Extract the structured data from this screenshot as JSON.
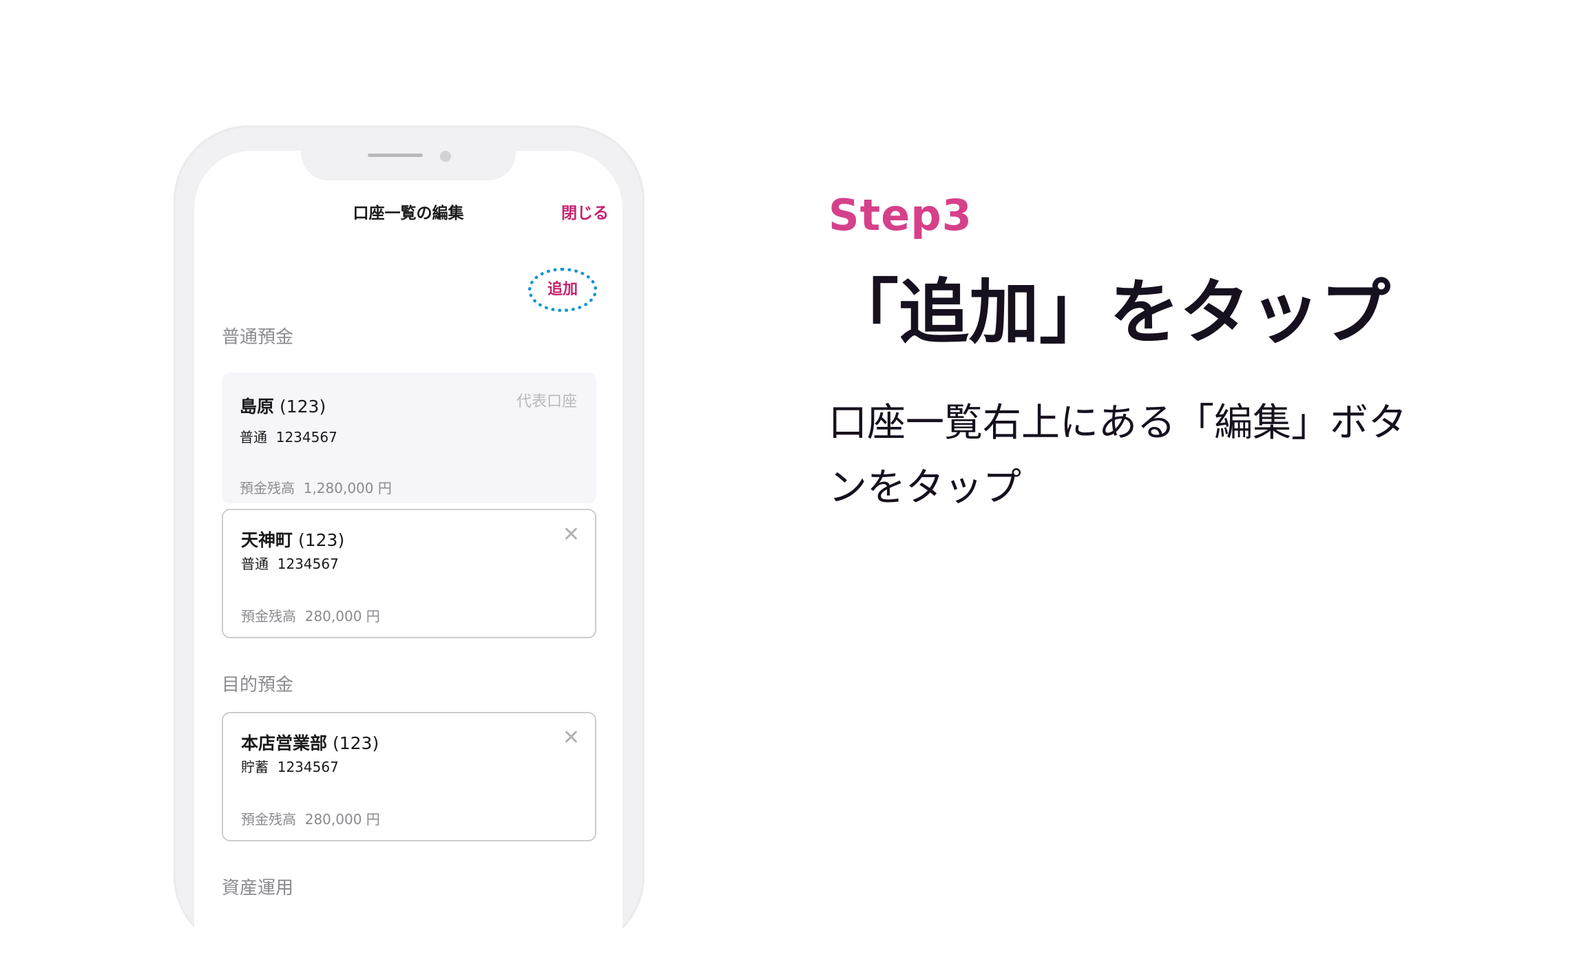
{
  "phone": {
    "nav_title": "口座一覧の編集",
    "close_label": "閉じる",
    "add_label": "追加",
    "sections": [
      {
        "label": "普通預金",
        "accounts": [
          {
            "branch": "島原",
            "code": "(123)",
            "type": "普通",
            "number": "1234567",
            "balance_label": "預金残高",
            "balance": "1,280,000 円",
            "tag": "代表口座"
          }
        ]
      },
      {
        "label": "",
        "accounts": [
          {
            "branch": "天神町",
            "code": "(123)",
            "type": "普通",
            "number": "1234567",
            "balance_label": "預金残高",
            "balance": "280,000 円",
            "close_glyph": "✕"
          }
        ]
      },
      {
        "label": "目的預金",
        "accounts": [
          {
            "branch": "本店営業部",
            "code": "(123)",
            "type": "貯蓄",
            "number": "1234567",
            "balance_label": "預金残高",
            "balance": "280,000 円",
            "close_glyph": "✕"
          }
        ]
      },
      {
        "label": "資産運用",
        "accounts": []
      }
    ]
  },
  "instruction": {
    "step": "Step3",
    "headline": "「追加」をタップ",
    "description": "口座一覧右上にある「編集」ボタンをタップ"
  },
  "colors": {
    "accent": "#c5246e",
    "step": "#d6408a",
    "highlight": "#1696d1"
  }
}
